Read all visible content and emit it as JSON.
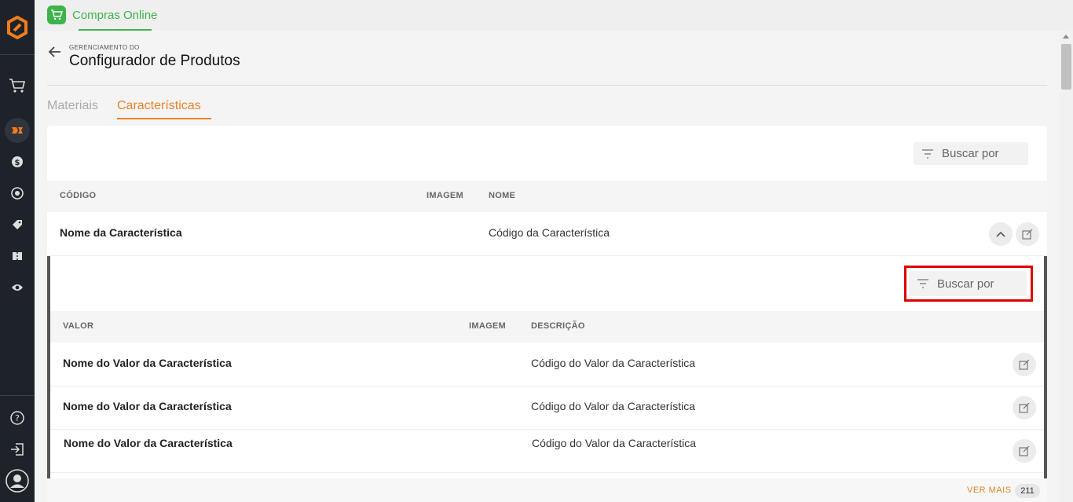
{
  "app_tab": {
    "label": "Compras Online"
  },
  "header": {
    "subtitle": "GERENCIAMENTO DO",
    "title": "Configurador de Produtos"
  },
  "tabs": [
    {
      "label": "Materiais",
      "active": false
    },
    {
      "label": "Características",
      "active": true
    }
  ],
  "search": {
    "label_top": "Buscar por",
    "label_inner": "Buscar por"
  },
  "table": {
    "headers": {
      "codigo": "CÓDIGO",
      "imagem": "IMAGEM",
      "nome": "NOME"
    },
    "row": {
      "codigo": "Nome da Característica",
      "nome": "Código da Característica"
    }
  },
  "subtable": {
    "headers": {
      "valor": "VALOR",
      "imagem": "IMAGEM",
      "descricao": "DESCRIÇÃO"
    },
    "rows": [
      {
        "valor": "Nome do Valor da Característica",
        "descricao": "Código do Valor da Característica"
      },
      {
        "valor": "Nome do Valor da Característica",
        "descricao": "Código do Valor da Característica"
      },
      {
        "valor": "Nome do Valor da Característica",
        "descricao": "Código do Valor da Característica"
      }
    ]
  },
  "footer": {
    "ver_mais": "VER MAIS",
    "count": "211"
  },
  "colors": {
    "accent_orange": "#e8832a",
    "accent_green": "#3cb44b",
    "sidebar_bg": "#1e2329",
    "highlight": "#e00000"
  }
}
